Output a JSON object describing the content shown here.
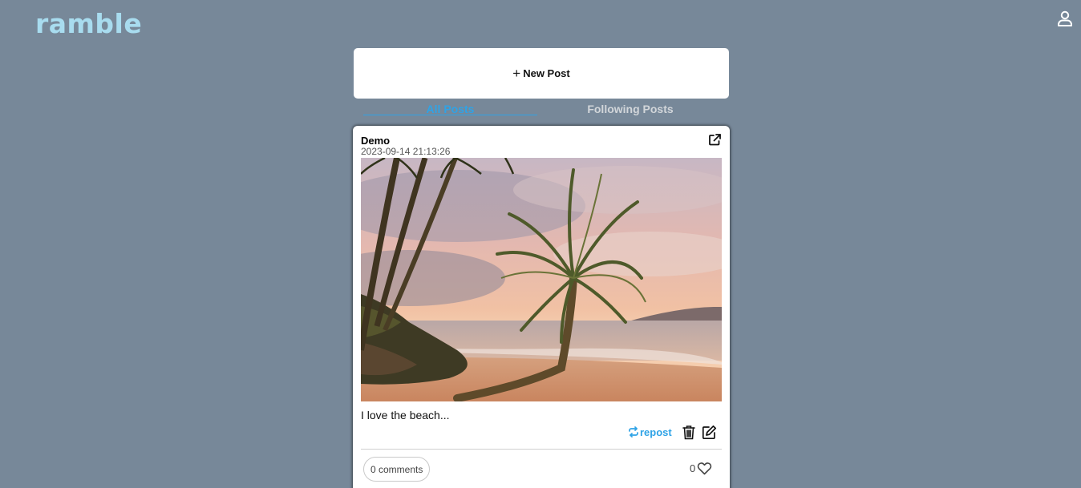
{
  "app": {
    "logo": "ramble"
  },
  "header": {
    "profile_icon": "user-icon"
  },
  "composer": {
    "plus": "+",
    "new_post_label": "New Post"
  },
  "tabs": [
    {
      "label": "All Posts",
      "active": true
    },
    {
      "label": "Following Posts",
      "active": false
    }
  ],
  "post": {
    "author": "Demo",
    "timestamp": "2023-09-14 21:13:26",
    "image": "palm-tree-beach-sunset-photo",
    "caption": "I love the beach...",
    "repost_label": "repost",
    "comments_label": "0 comments",
    "likes": "0"
  },
  "colors": {
    "background": "#778899",
    "accent": "#2fa3e6",
    "logo": "#a8dcef",
    "card": "#ffffff"
  }
}
